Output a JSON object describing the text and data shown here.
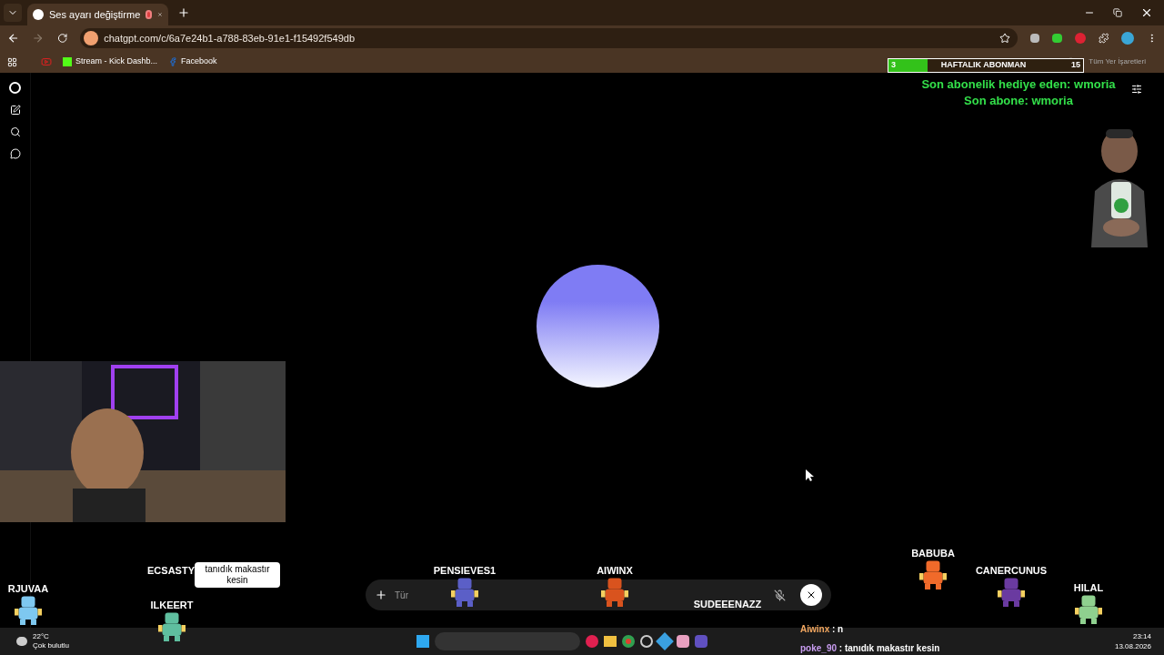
{
  "browser": {
    "tab": {
      "title": "Ses ayarı değiştirme",
      "recording": true
    },
    "url": "chatgpt.com/c/6a7e24b1-a788-83eb-91e1-f15492f549db",
    "bookmarks": [
      {
        "label": "Stream - Kick Dashb...",
        "kind": "kick"
      },
      {
        "label": "Facebook",
        "kind": "facebook"
      }
    ],
    "bookmarks_folder": "Tüm Yer İşaretleri"
  },
  "overlay": {
    "goal": {
      "current": "3",
      "title": "HAFTALIK ABONMAN",
      "target": "15",
      "level": 0.2
    },
    "alerts": [
      "Son abonelik hediye eden: wmoria",
      "Son abone: wmoria"
    ],
    "sprites": [
      {
        "name": "RJUVAA",
        "color": "#7ec8f0"
      },
      {
        "name": "ECSASTY"
      },
      {
        "name": "ILKEERT",
        "color": "#5fbf9f"
      },
      {
        "name": "PENSIEVES1",
        "color": "#5b5fc7"
      },
      {
        "name": "AIWINX",
        "color": "#d9531e"
      },
      {
        "name": "SUDEEENAZZ"
      },
      {
        "name": "BABUBA",
        "color": "#f06a2a"
      },
      {
        "name": "CANERCUNUS",
        "color": "#6a3aa0"
      },
      {
        "name": "HILAL",
        "color": "#8fd08f"
      }
    ],
    "bubble": "tanıdık  makastır kesin",
    "chat": [
      {
        "user": "Aiwinx",
        "text": " : n",
        "color": "#f4a860"
      },
      {
        "user": "poke_90",
        "text": " : tanıdık makastır kesin",
        "color": "#c89cf0"
      }
    ]
  },
  "voice": {
    "placeholder": "Tür",
    "muted": true
  },
  "taskbar": {
    "temperature": "22°C",
    "weather": "Çok bulutlu",
    "time": "23:14",
    "date": "13.08.2026"
  }
}
